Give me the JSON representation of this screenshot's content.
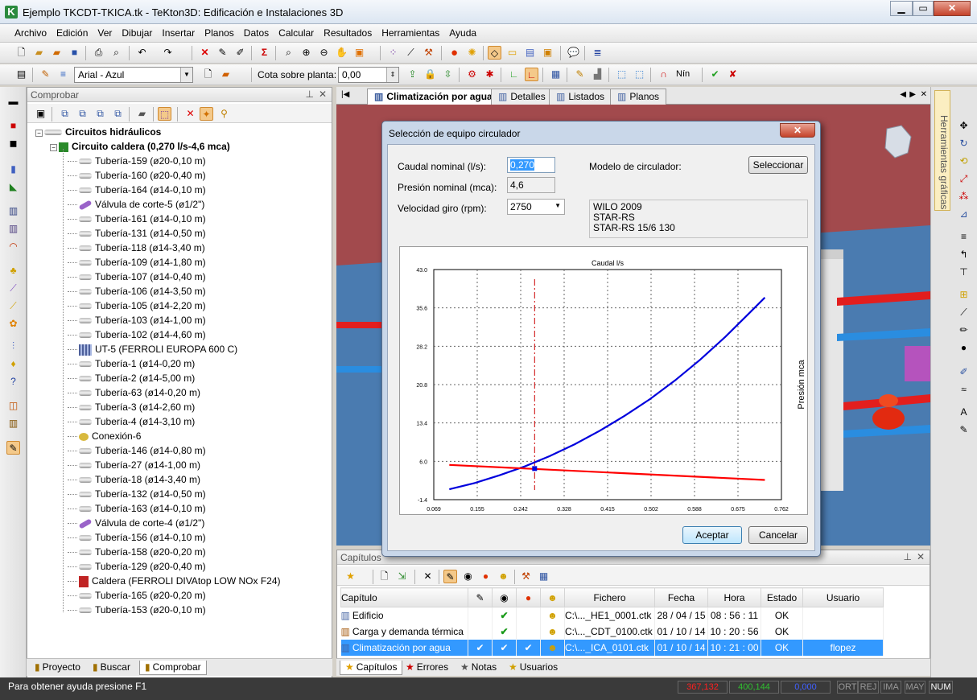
{
  "window": {
    "title": "Ejemplo TKCDT-TKICA.tk - TeKton3D: Edificación e Instalaciones 3D"
  },
  "menu": [
    "Archivo",
    "Edición",
    "Ver",
    "Dibujar",
    "Insertar",
    "Planos",
    "Datos",
    "Calcular",
    "Resultados",
    "Herramientas",
    "Ayuda"
  ],
  "toolbar2": {
    "font_combo": "Arial - Azul",
    "cota_label": "Cota sobre planta:",
    "cota_value": "0,00",
    "nin": "Nín"
  },
  "left_panel": {
    "title": "Comprobar",
    "root": "Circuitos hidráulicos",
    "circuit": "Circuito caldera (0,270 l/s-4,6 mca)",
    "items": [
      {
        "t": "pipe",
        "label": "Tubería-159 (ø20-0,10 m)"
      },
      {
        "t": "pipe",
        "label": "Tubería-160 (ø20-0,40 m)"
      },
      {
        "t": "pipe",
        "label": "Tubería-164 (ø14-0,10 m)"
      },
      {
        "t": "valve",
        "label": "Válvula de corte-5 (ø1/2\")"
      },
      {
        "t": "pipe",
        "label": "Tubería-161 (ø14-0,10 m)"
      },
      {
        "t": "pipe",
        "label": "Tubería-131 (ø14-0,50 m)"
      },
      {
        "t": "pipe",
        "label": "Tubería-118 (ø14-3,40 m)"
      },
      {
        "t": "pipe",
        "label": "Tubería-109 (ø14-1,80 m)"
      },
      {
        "t": "pipe",
        "label": "Tubería-107 (ø14-0,40 m)"
      },
      {
        "t": "pipe",
        "label": "Tubería-106 (ø14-3,50 m)"
      },
      {
        "t": "pipe",
        "label": "Tubería-105 (ø14-2,20 m)"
      },
      {
        "t": "pipe",
        "label": "Tubería-103 (ø14-1,00 m)"
      },
      {
        "t": "pipe",
        "label": "Tubería-102 (ø14-4,60 m)"
      },
      {
        "t": "unit",
        "label": "UT-5 (FERROLI EUROPA 600 C)"
      },
      {
        "t": "pipe",
        "label": "Tubería-1 (ø14-0,20 m)"
      },
      {
        "t": "pipe",
        "label": "Tubería-2 (ø14-5,00 m)"
      },
      {
        "t": "pipe",
        "label": "Tubería-63 (ø14-0,20 m)"
      },
      {
        "t": "pipe",
        "label": "Tubería-3 (ø14-2,60 m)"
      },
      {
        "t": "pipe",
        "label": "Tubería-4 (ø14-3,10 m)"
      },
      {
        "t": "conn",
        "label": "Conexión-6"
      },
      {
        "t": "pipe",
        "label": "Tubería-146 (ø14-0,80 m)"
      },
      {
        "t": "pipe",
        "label": "Tubería-27 (ø14-1,00 m)"
      },
      {
        "t": "pipe",
        "label": "Tubería-18 (ø14-3,40 m)"
      },
      {
        "t": "pipe",
        "label": "Tubería-132 (ø14-0,50 m)"
      },
      {
        "t": "pipe",
        "label": "Tubería-163 (ø14-0,10 m)"
      },
      {
        "t": "valve",
        "label": "Válvula de corte-4 (ø1/2\")"
      },
      {
        "t": "pipe",
        "label": "Tubería-156 (ø14-0,10 m)"
      },
      {
        "t": "pipe",
        "label": "Tubería-158 (ø20-0,20 m)"
      },
      {
        "t": "pipe",
        "label": "Tubería-129 (ø20-0,40 m)"
      },
      {
        "t": "boiler",
        "label": "Caldera (FERROLI DIVAtop LOW NOx F24)"
      },
      {
        "t": "pipe",
        "label": "Tubería-165 (ø20-0,20 m)"
      },
      {
        "t": "pipe",
        "label": "Tubería-153 (ø20-0,10 m)"
      }
    ],
    "tabs": [
      "Proyecto",
      "Buscar",
      "Comprobar"
    ]
  },
  "view_tabs": [
    "Climatización por agua",
    "Detalles",
    "Listados",
    "Planos"
  ],
  "right_panel": {
    "label": "Herramientas gráficas"
  },
  "chapters": {
    "title": "Capítulos",
    "headers": [
      "Capítulo",
      "",
      "",
      "",
      "",
      "Fichero",
      "Fecha",
      "Hora",
      "Estado",
      "Usuario"
    ],
    "rows": [
      {
        "name": "Edificio",
        "c1": "",
        "c2": "✔",
        "c3": "",
        "file": "C:\\..._HE1_0001.ctk",
        "date": "28 / 04 / 15",
        "time": "08 : 56 : 11",
        "state": "OK",
        "user": ""
      },
      {
        "name": "Carga y demanda térmica",
        "c1": "",
        "c2": "✔",
        "c3": "",
        "file": "C:\\..._CDT_0100.ctk",
        "date": "01 / 10 / 14",
        "time": "10 : 20 : 56",
        "state": "OK",
        "user": ""
      },
      {
        "name": "Climatización por agua",
        "c1": "✔",
        "c2": "✔",
        "c3": "✔",
        "file": "C:\\..._ICA_0101.ctk",
        "date": "01 / 10 / 14",
        "time": "10 : 21 : 00",
        "state": "OK",
        "user": "flopez"
      }
    ],
    "tabs": [
      "Capítulos",
      "Errores",
      "Notas",
      "Usuarios"
    ]
  },
  "status": {
    "help": "Para obtener ayuda presione F1",
    "c1": "367,132",
    "c2": "400,144",
    "c3": "0,000",
    "ind": [
      "ORT",
      "REJ",
      "IMA",
      "MAY",
      "NUM"
    ]
  },
  "dialog": {
    "title": "Selección de equipo circulador",
    "caudal_label": "Caudal nominal (l/s):",
    "caudal_value": "0,270",
    "presion_label": "Presión nominal (mca):",
    "presion_value": "4,6",
    "velocidad_label": "Velocidad giro (rpm):",
    "velocidad_value": "2750",
    "modelo_label": "Modelo de circulador:",
    "seleccionar": "Seleccionar",
    "modelo_lines": [
      "WILO 2009",
      "STAR-RS",
      "STAR-RS 15/6 130"
    ],
    "aceptar": "Aceptar",
    "cancelar": "Cancelar"
  },
  "chart_data": {
    "type": "line",
    "title": "Caudal l/s",
    "ylabel": "Presión mca",
    "xlim": [
      0.069,
      0.762
    ],
    "ylim": [
      -1.4,
      43.0
    ],
    "xticks": [
      "0.069",
      "0.155",
      "0.242",
      "0.328",
      "0.415",
      "0.502",
      "0.588",
      "0.675",
      "0.762"
    ],
    "yticks": [
      "43.0",
      "35.6",
      "28.2",
      "20.8",
      "13.4",
      "6.0",
      "-1.4"
    ],
    "grid": true,
    "series": [
      {
        "color": "#0000dd",
        "x": [
          0.1,
          0.15,
          0.2,
          0.25,
          0.3,
          0.35,
          0.4,
          0.45,
          0.5,
          0.55,
          0.6,
          0.65,
          0.7,
          0.729
        ],
        "y": [
          0.6,
          1.8,
          3.3,
          5.0,
          7.0,
          9.3,
          11.9,
          14.8,
          18.0,
          21.6,
          25.6,
          30.0,
          34.8,
          37.6
        ]
      },
      {
        "color": "#ff0000",
        "x": [
          0.1,
          0.729
        ],
        "y": [
          5.3,
          2.4
        ]
      }
    ],
    "operating_point": {
      "x": 0.27,
      "y": 4.6
    },
    "marker_x": 0.27
  }
}
